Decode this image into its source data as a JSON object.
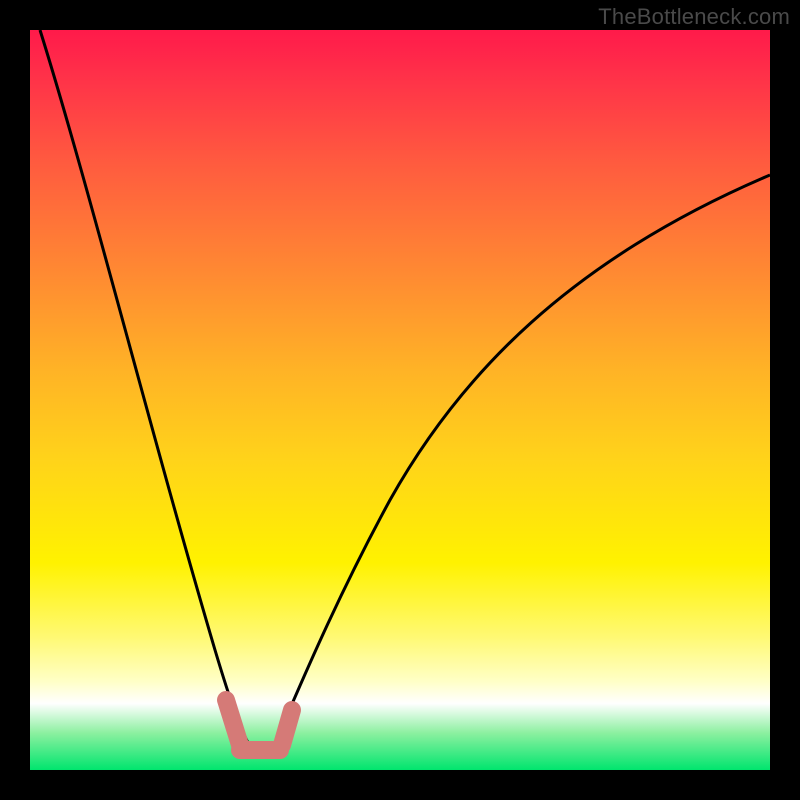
{
  "watermark": "TheBottleneck.com",
  "chart_data": {
    "type": "line",
    "title": "",
    "xlabel": "",
    "ylabel": "",
    "xlim": [
      0,
      100
    ],
    "ylim": [
      0,
      100
    ],
    "series": [
      {
        "name": "curve",
        "x": [
          0,
          4,
          8,
          12,
          16,
          20,
          24,
          26,
          28,
          30,
          32,
          34,
          36,
          40,
          45,
          50,
          56,
          63,
          72,
          82,
          92,
          100
        ],
        "y": [
          100,
          84,
          68,
          53,
          39,
          26,
          13,
          7,
          3,
          1,
          1,
          4,
          11,
          22,
          33,
          42,
          50,
          57,
          64,
          70,
          75,
          78
        ]
      }
    ],
    "markers": [
      {
        "name": "left-notch",
        "x": [
          26,
          27.5
        ],
        "y": [
          7,
          2
        ]
      },
      {
        "name": "right-notch",
        "x": [
          33,
          34
        ],
        "y": [
          4,
          10
        ]
      },
      {
        "name": "bottom-bar",
        "x": [
          27.5,
          33
        ],
        "y": [
          2,
          2
        ]
      }
    ],
    "colors": {
      "curve": "#000000",
      "marker": "#d57a77",
      "gradient_top": "#ff1a4a",
      "gradient_bottom": "#00e56e",
      "frame": "#000000"
    }
  }
}
